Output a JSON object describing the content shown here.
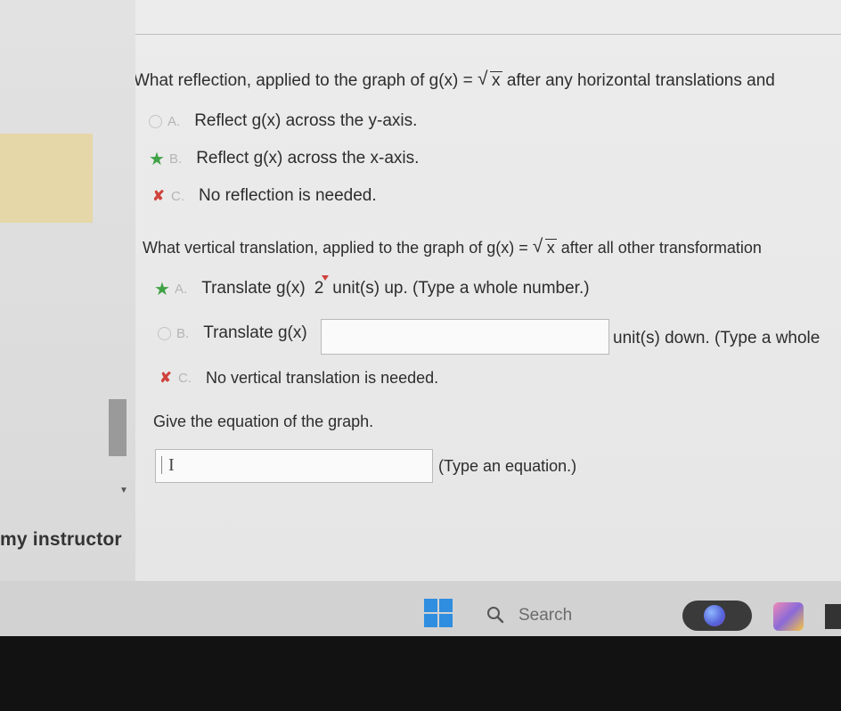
{
  "sidebar": {
    "footer_text": "my instructor"
  },
  "question1": {
    "text_before": "What reflection, applied to the graph of g(x) =",
    "radicand": "x",
    "text_after": "after any horizontal translations and",
    "options": [
      {
        "letter": "A.",
        "label": "Reflect g(x) across the y-axis.",
        "status": "unselected"
      },
      {
        "letter": "B.",
        "label": "Reflect g(x) across the x-axis.",
        "status": "correct"
      },
      {
        "letter": "C.",
        "label": "No reflection is needed.",
        "status": "incorrect"
      }
    ]
  },
  "question2": {
    "text_before": "What vertical translation, applied to the graph of g(x) =",
    "radicand": "x",
    "text_after": "after all other transformation",
    "option_a": {
      "letter": "A.",
      "prefix": "Translate g(x)",
      "value": "2",
      "suffix": "unit(s) up. (Type a whole number.)"
    },
    "option_b": {
      "letter": "B.",
      "prefix": "Translate g(x)",
      "value": "",
      "suffix": "unit(s) down. (Type a whole"
    },
    "option_c": {
      "letter": "C.",
      "label": "No vertical translation is needed."
    }
  },
  "question3": {
    "text": "Give the equation of the graph.",
    "input_value": "",
    "hint": "(Type an equation.)"
  },
  "taskbar": {
    "search_label": "Search"
  },
  "colors": {
    "correct": "#3fa245",
    "incorrect": "#d0423c",
    "windows_blue": "#2f8ee0"
  }
}
